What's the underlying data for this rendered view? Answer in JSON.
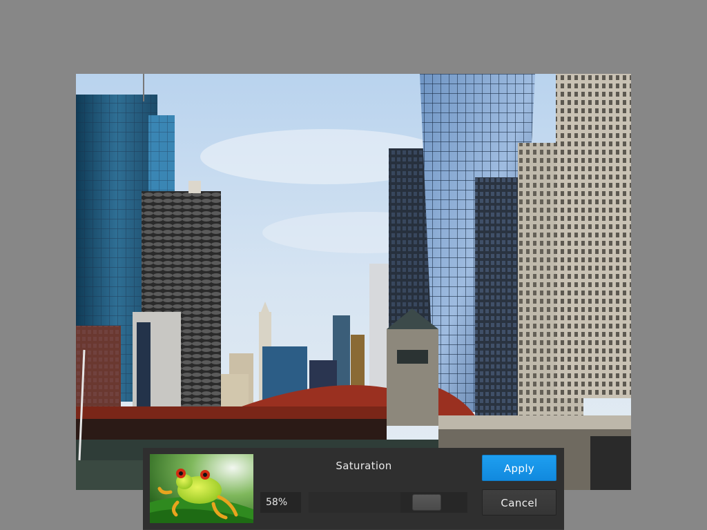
{
  "panel": {
    "title": "Saturation",
    "value_text": "58%",
    "value": 58,
    "apply_label": "Apply",
    "cancel_label": "Cancel"
  },
  "colors": {
    "background": "#878787",
    "panel": "#2f2f2f",
    "accent": "#1a95e8"
  },
  "canvas": {
    "image": "city-river-skyline-photo"
  },
  "thumbnail": {
    "image": "tree-frog-photo"
  }
}
